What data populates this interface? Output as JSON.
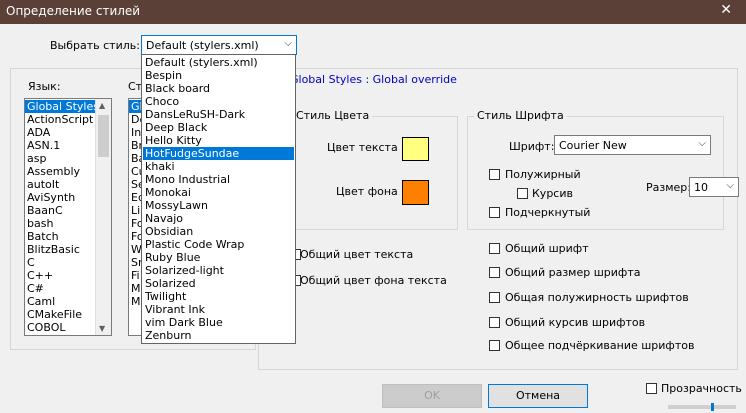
{
  "window": {
    "title": "Определение стилей",
    "close": "✕"
  },
  "style_select": {
    "label": "Выбрать стиль:",
    "value": "Default (stylers.xml)",
    "options": [
      "Default (stylers.xml)",
      "Bespin",
      "Black board",
      "Choco",
      "DansLeRuSH-Dark",
      "Deep Black",
      "Hello Kitty",
      "HotFudgeSundae",
      "khaki",
      "Mono Industrial",
      "Monokai",
      "MossyLawn",
      "Navajo",
      "Obsidian",
      "Plastic Code Wrap",
      "Ruby Blue",
      "Solarized-light",
      "Solarized",
      "Twilight",
      "Vibrant Ink",
      "vim Dark Blue",
      "Zenburn"
    ],
    "highlighted": "HotFudgeSundae"
  },
  "language": {
    "label": "Язык:",
    "items": [
      "Global Styles",
      "ActionScript",
      "ADA",
      "ASN.1",
      "asp",
      "Assembly",
      "autoIt",
      "AviSynth",
      "BaanC",
      "bash",
      "Batch",
      "BlitzBasic",
      "C",
      "C++",
      "C#",
      "Caml",
      "CMakeFile",
      "COBOL"
    ],
    "selected": "Global Styles"
  },
  "style_list": {
    "label": "Ст",
    "items": [
      "Gl",
      "De",
      "In",
      "Br",
      "Ba",
      "Cu",
      "Se",
      "Ed",
      "Li",
      "Fo",
      "Fo",
      "Wi",
      "Sm",
      "Fi",
      "M",
      "M"
    ]
  },
  "header": {
    "text": "Global Styles : Global override"
  },
  "color_style": {
    "title": "Стиль Цвета",
    "fg_label": "Цвет текста",
    "bg_label": "Цвет фона",
    "fg_color": "#ffff80",
    "bg_color": "#ff8000"
  },
  "font_style": {
    "title": "Стиль Шрифта",
    "font_label": "Шрифт:",
    "font_value": "Courier New",
    "bold": "Полужирный",
    "italic": "Курсив",
    "underline": "Подчеркнутый",
    "size_label": "Размер:",
    "size_value": "10"
  },
  "global_left": {
    "fg": "Общий цвет текста",
    "bg": "Общий цвет фона текста"
  },
  "global_right": {
    "font": "Общий шрифт",
    "size": "Общий размер шрифта",
    "bold": "Общая полужирность шрифтов",
    "italic": "Общий курсив шрифтов",
    "underline": "Общее подчёркивание шрифтов"
  },
  "buttons": {
    "ok": "OK",
    "cancel": "Отмена"
  },
  "transparency": {
    "label": "Прозрачность"
  },
  "icons": {
    "dropdown": "chevron-down-icon",
    "close": "close-icon"
  }
}
